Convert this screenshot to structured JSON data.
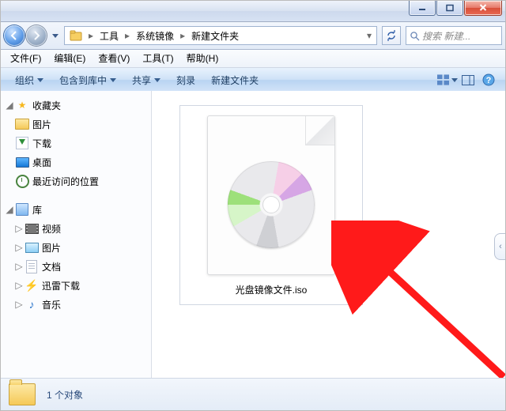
{
  "breadcrumb": {
    "items": [
      "工具",
      "系统镜像",
      "新建文件夹"
    ]
  },
  "search": {
    "placeholder": "搜索 新建..."
  },
  "menu": {
    "file": "文件(F)",
    "edit": "编辑(E)",
    "view": "查看(V)",
    "tools": "工具(T)",
    "help": "帮助(H)"
  },
  "cmd": {
    "organize": "组织",
    "include": "包含到库中",
    "share": "共享",
    "burn": "刻录",
    "new_folder": "新建文件夹"
  },
  "nav": {
    "favorites": "收藏夹",
    "fav_items": {
      "pictures": "图片",
      "downloads": "下载",
      "desktop": "桌面",
      "recent": "最近访问的位置"
    },
    "libraries": "库",
    "lib_items": {
      "videos": "视频",
      "pictures": "图片",
      "documents": "文档",
      "xunlei": "迅雷下载",
      "music": "音乐"
    }
  },
  "content": {
    "file_name": "光盘镜像文件.iso"
  },
  "status": {
    "text": "1 个对象"
  }
}
